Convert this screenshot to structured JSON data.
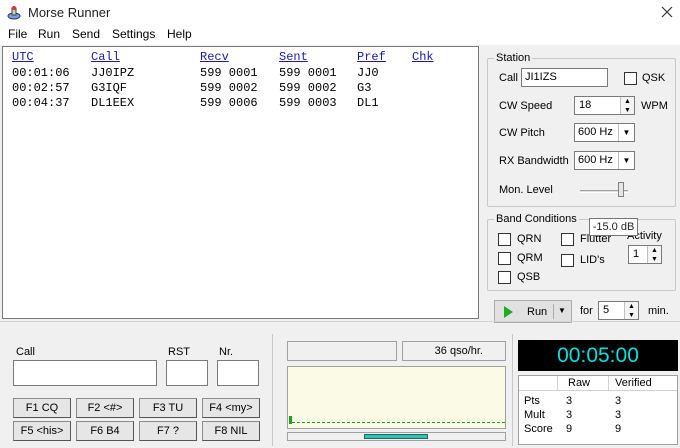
{
  "window": {
    "title": "Morse Runner"
  },
  "menu": [
    "File",
    "Run",
    "Send",
    "Settings",
    "Help"
  ],
  "log": {
    "columns": [
      "UTC",
      "Call",
      "Recv",
      "Sent",
      "Pref",
      "Chk"
    ],
    "rows": [
      {
        "utc": "00:01:06",
        "call": "JJ0IPZ",
        "recv": "599 0001",
        "sent": "599 0001",
        "pref": "JJ0",
        "chk": ""
      },
      {
        "utc": "00:02:57",
        "call": "G3IQF",
        "recv": "599 0002",
        "sent": "599 0002",
        "pref": "G3",
        "chk": ""
      },
      {
        "utc": "00:04:37",
        "call": "DL1EEX",
        "recv": "599 0006",
        "sent": "599 0003",
        "pref": "DL1",
        "chk": ""
      }
    ]
  },
  "station": {
    "group_label": "Station",
    "call_label": "Call",
    "call_value": "JI1IZS",
    "qsk_label": "QSK",
    "cw_speed_label": "CW Speed",
    "cw_speed_value": "18",
    "wpm_label": "WPM",
    "cw_pitch_label": "CW Pitch",
    "cw_pitch_value": "600 Hz",
    "rx_bandwidth_label": "RX Bandwidth",
    "rx_bandwidth_value": "600 Hz",
    "mon_level_label": "Mon. Level",
    "mon_level_tooltip": "-15.0 dB"
  },
  "band_conditions": {
    "group_label": "Band Conditions",
    "qrn_label": "QRN",
    "qrm_label": "QRM",
    "qsb_label": "QSB",
    "flutter_label": "Flutter",
    "lids_label": "LID's",
    "activity_label": "Activity",
    "activity_value": "1"
  },
  "run_control": {
    "run_label": "Run",
    "for_label": "for",
    "minutes_value": "5",
    "min_label": "min."
  },
  "entry": {
    "call_label": "Call",
    "rst_label": "RST",
    "nr_label": "Nr.",
    "call_value": "",
    "rst_value": "",
    "nr_value": ""
  },
  "function_keys": [
    "F1 CQ",
    "F2 <#>",
    "F3 TU",
    "F4 <my>",
    "F5 <his>",
    "F6 B4",
    "F7 ?",
    "F8 NIL"
  ],
  "status": {
    "rate_text": "36 qso/hr.",
    "timer": "00:05:00"
  },
  "score": {
    "headers": [
      "",
      "Raw",
      "Verified"
    ],
    "rows": [
      {
        "label": "Pts",
        "raw": "3",
        "verified": "3"
      },
      {
        "label": "Mult",
        "raw": "3",
        "verified": "3"
      },
      {
        "label": "Score",
        "raw": "9",
        "verified": "9"
      }
    ]
  },
  "colors": {
    "timer_bg": "#000000",
    "timer_fg": "#00e0e0",
    "log_header": "#1a1aa6",
    "run_arrow": "#22aa22",
    "signal_bg": "#fafae6",
    "progress": "#37c0b0"
  }
}
